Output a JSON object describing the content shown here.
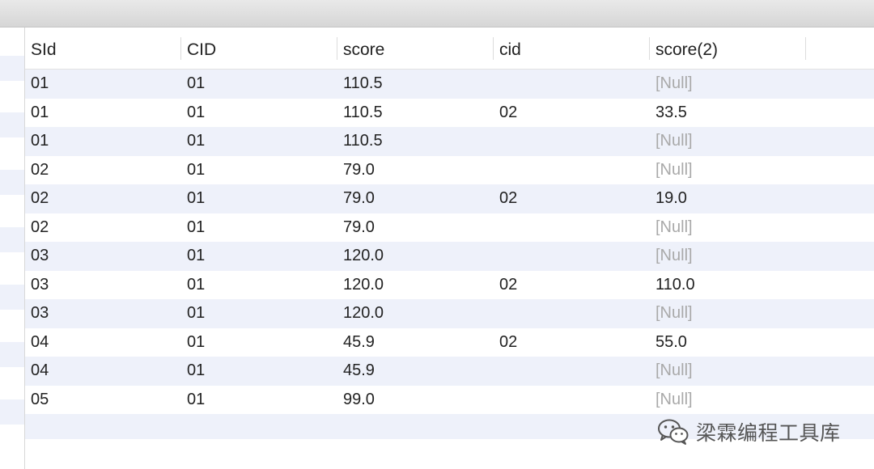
{
  "grid": {
    "columns": [
      "SId",
      "CID",
      "score",
      "cid",
      "score(2)"
    ],
    "rows": [
      [
        "01",
        "01",
        "110.5",
        "",
        "[Null]"
      ],
      [
        "01",
        "01",
        "110.5",
        "02",
        "33.5"
      ],
      [
        "01",
        "01",
        "110.5",
        "",
        "[Null]"
      ],
      [
        "02",
        "01",
        "79.0",
        "",
        "[Null]"
      ],
      [
        "02",
        "01",
        "79.0",
        "02",
        "19.0"
      ],
      [
        "02",
        "01",
        "79.0",
        "",
        "[Null]"
      ],
      [
        "03",
        "01",
        "120.0",
        "",
        "[Null]"
      ],
      [
        "03",
        "01",
        "120.0",
        "02",
        "110.0"
      ],
      [
        "03",
        "01",
        "120.0",
        "",
        "[Null]"
      ],
      [
        "04",
        "01",
        "45.9",
        "02",
        "55.0"
      ],
      [
        "04",
        "01",
        "45.9",
        "",
        "[Null]"
      ],
      [
        "05",
        "01",
        "99.0",
        "",
        "[Null]"
      ]
    ],
    "null_text": "[Null]"
  },
  "watermark": {
    "icon": "wechat-icon",
    "text": "梁霖编程工具库"
  },
  "colors": {
    "stripe": "#eef1fa",
    "null_text": "#a9a9a9",
    "text": "#222222"
  }
}
